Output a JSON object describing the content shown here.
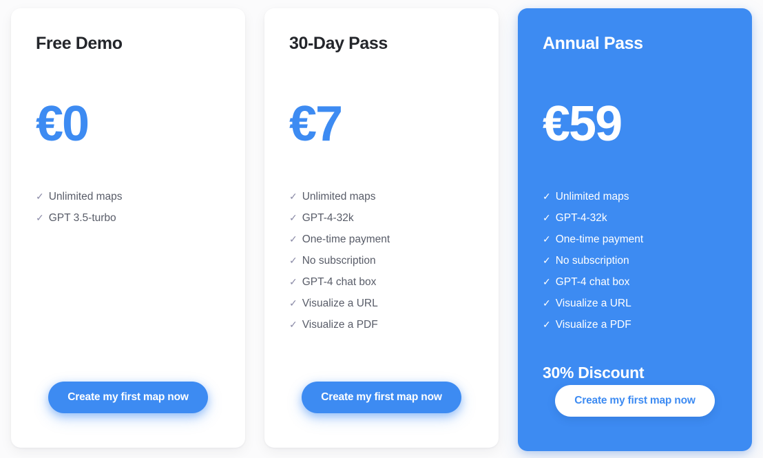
{
  "background_color": "#fbfbfc",
  "accent_color": "#3d8bf2",
  "check_glyph": "✓",
  "plans": [
    {
      "id": "free-demo",
      "title": "Free Demo",
      "price": "€0",
      "highlighted": false,
      "features": [
        "Unlimited maps",
        "GPT 3.5-turbo"
      ],
      "discount": "",
      "cta_label": "Create my first map now"
    },
    {
      "id": "thirty-day-pass",
      "title": "30-Day Pass",
      "price": "€7",
      "highlighted": false,
      "features": [
        "Unlimited maps",
        "GPT-4-32k",
        "One-time payment",
        "No subscription",
        "GPT-4 chat box",
        "Visualize a URL",
        "Visualize a PDF"
      ],
      "discount": "",
      "cta_label": "Create my first map now"
    },
    {
      "id": "annual-pass",
      "title": "Annual Pass",
      "price": "€59",
      "highlighted": true,
      "features": [
        "Unlimited maps",
        "GPT-4-32k",
        "One-time payment",
        "No subscription",
        "GPT-4 chat box",
        "Visualize a URL",
        "Visualize a PDF"
      ],
      "discount": "30% Discount",
      "cta_label": "Create my first map now"
    }
  ]
}
